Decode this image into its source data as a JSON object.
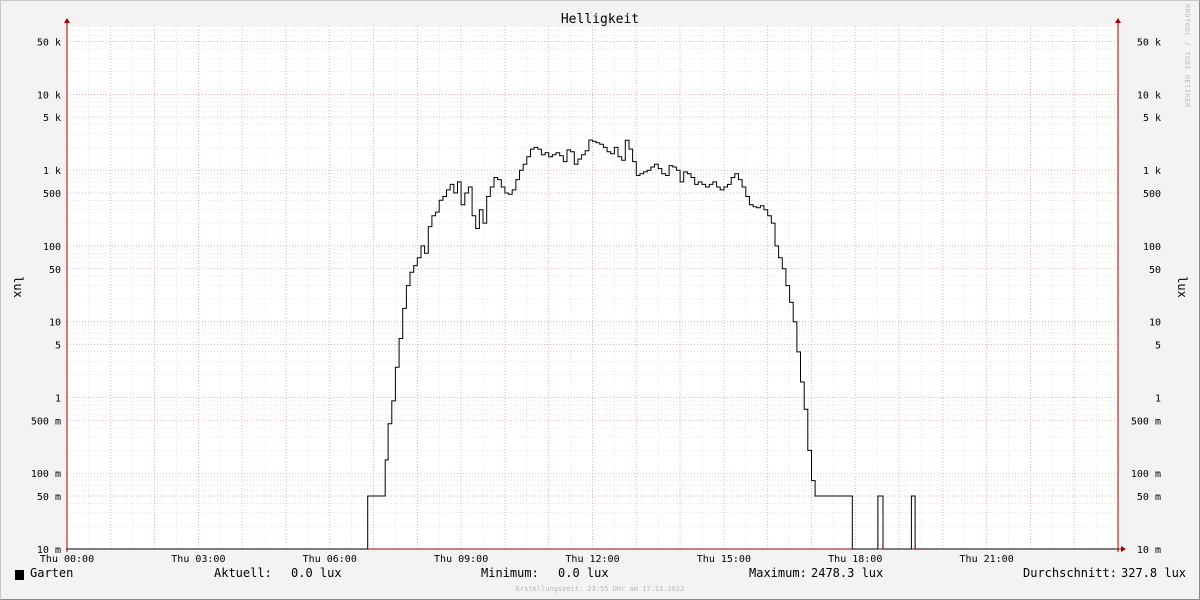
{
  "chart_data": {
    "type": "line",
    "title": "Helligkeit",
    "ylabel": "lux",
    "y_scale": "log",
    "ylim": [
      0.01,
      80000
    ],
    "xlim": [
      "00:00",
      "24:00"
    ],
    "grid": true,
    "y_ticks": [
      {
        "value": 50000,
        "label": "50 k"
      },
      {
        "value": 10000,
        "label": "10 k"
      },
      {
        "value": 5000,
        "label": "5 k"
      },
      {
        "value": 1000,
        "label": "1 k"
      },
      {
        "value": 500,
        "label": "500"
      },
      {
        "value": 100,
        "label": "100"
      },
      {
        "value": 50,
        "label": "50"
      },
      {
        "value": 10,
        "label": "10"
      },
      {
        "value": 5,
        "label": "5"
      },
      {
        "value": 1,
        "label": "1"
      },
      {
        "value": 0.5,
        "label": "500 m"
      },
      {
        "value": 0.1,
        "label": "100 m"
      },
      {
        "value": 0.05,
        "label": "50 m"
      },
      {
        "value": 0.01,
        "label": "10 m"
      }
    ],
    "x_ticks": [
      {
        "value": "00:00",
        "label": "Thu 00:00"
      },
      {
        "value": "03:00",
        "label": "Thu 03:00"
      },
      {
        "value": "06:00",
        "label": "Thu 06:00"
      },
      {
        "value": "09:00",
        "label": "Thu 09:00"
      },
      {
        "value": "12:00",
        "label": "Thu 12:00"
      },
      {
        "value": "15:00",
        "label": "Thu 15:00"
      },
      {
        "value": "18:00",
        "label": "Thu 18:00"
      },
      {
        "value": "21:00",
        "label": "Thu 21:00"
      }
    ],
    "series": [
      {
        "name": "Garten",
        "color": "#000000",
        "points": [
          [
            "00:00",
            0.01
          ],
          [
            "06:51",
            0.01
          ],
          [
            "06:52",
            0.05
          ],
          [
            "07:15",
            0.05
          ],
          [
            "07:16",
            0.15
          ],
          [
            "07:20",
            0.45
          ],
          [
            "07:25",
            0.9
          ],
          [
            "07:30",
            2.5
          ],
          [
            "07:35",
            6
          ],
          [
            "07:40",
            15
          ],
          [
            "07:45",
            30
          ],
          [
            "07:50",
            45
          ],
          [
            "07:55",
            55
          ],
          [
            "08:00",
            70
          ],
          [
            "08:05",
            100
          ],
          [
            "08:10",
            80
          ],
          [
            "08:15",
            180
          ],
          [
            "08:20",
            250
          ],
          [
            "08:25",
            280
          ],
          [
            "08:30",
            400
          ],
          [
            "08:35",
            450
          ],
          [
            "08:40",
            550
          ],
          [
            "08:45",
            650
          ],
          [
            "08:50",
            500
          ],
          [
            "08:55",
            700
          ],
          [
            "09:00",
            350
          ],
          [
            "09:05",
            500
          ],
          [
            "09:10",
            600
          ],
          [
            "09:15",
            250
          ],
          [
            "09:20",
            170
          ],
          [
            "09:25",
            300
          ],
          [
            "09:30",
            200
          ],
          [
            "09:35",
            450
          ],
          [
            "09:40",
            600
          ],
          [
            "09:45",
            800
          ],
          [
            "09:50",
            750
          ],
          [
            "09:55",
            600
          ],
          [
            "10:00",
            500
          ],
          [
            "10:05",
            480
          ],
          [
            "10:10",
            550
          ],
          [
            "10:15",
            750
          ],
          [
            "10:20",
            1000
          ],
          [
            "10:25",
            1200
          ],
          [
            "10:30",
            1500
          ],
          [
            "10:35",
            1900
          ],
          [
            "10:40",
            2000
          ],
          [
            "10:45",
            1900
          ],
          [
            "10:50",
            1600
          ],
          [
            "10:55",
            1700
          ],
          [
            "11:00",
            1500
          ],
          [
            "11:05",
            1600
          ],
          [
            "11:10",
            1700
          ],
          [
            "11:15",
            1550
          ],
          [
            "11:20",
            1300
          ],
          [
            "11:25",
            1850
          ],
          [
            "11:30",
            1750
          ],
          [
            "11:35",
            1200
          ],
          [
            "11:40",
            1400
          ],
          [
            "11:45",
            1600
          ],
          [
            "11:50",
            1800
          ],
          [
            "11:55",
            2500
          ],
          [
            "12:00",
            2400
          ],
          [
            "12:05",
            2300
          ],
          [
            "12:10",
            2200
          ],
          [
            "12:15",
            2000
          ],
          [
            "12:20",
            1750
          ],
          [
            "12:25",
            1650
          ],
          [
            "12:30",
            2000
          ],
          [
            "12:35",
            1500
          ],
          [
            "12:40",
            1350
          ],
          [
            "12:45",
            2478.3
          ],
          [
            "12:50",
            1900
          ],
          [
            "12:55",
            1300
          ],
          [
            "13:00",
            850
          ],
          [
            "13:05",
            900
          ],
          [
            "13:10",
            950
          ],
          [
            "13:15",
            1000
          ],
          [
            "13:20",
            1100
          ],
          [
            "13:25",
            1200
          ],
          [
            "13:30",
            1050
          ],
          [
            "13:35",
            900
          ],
          [
            "13:40",
            850
          ],
          [
            "13:45",
            1150
          ],
          [
            "13:50",
            1100
          ],
          [
            "13:55",
            1000
          ],
          [
            "14:00",
            700
          ],
          [
            "14:05",
            950
          ],
          [
            "14:10",
            900
          ],
          [
            "14:15",
            800
          ],
          [
            "14:20",
            650
          ],
          [
            "14:25",
            700
          ],
          [
            "14:30",
            650
          ],
          [
            "14:35",
            600
          ],
          [
            "14:40",
            650
          ],
          [
            "14:45",
            700
          ],
          [
            "14:50",
            600
          ],
          [
            "14:55",
            550
          ],
          [
            "15:00",
            600
          ],
          [
            "15:05",
            650
          ],
          [
            "15:10",
            800
          ],
          [
            "15:15",
            900
          ],
          [
            "15:20",
            750
          ],
          [
            "15:25",
            600
          ],
          [
            "15:30",
            450
          ],
          [
            "15:35",
            350
          ],
          [
            "15:40",
            330
          ],
          [
            "15:45",
            320
          ],
          [
            "15:50",
            340
          ],
          [
            "15:55",
            300
          ],
          [
            "16:00",
            250
          ],
          [
            "16:05",
            200
          ],
          [
            "16:10",
            100
          ],
          [
            "16:15",
            70
          ],
          [
            "16:20",
            50
          ],
          [
            "16:25",
            30
          ],
          [
            "16:30",
            18
          ],
          [
            "16:35",
            10
          ],
          [
            "16:40",
            4
          ],
          [
            "16:45",
            1.6
          ],
          [
            "16:50",
            0.7
          ],
          [
            "16:55",
            0.2
          ],
          [
            "17:00",
            0.08
          ],
          [
            "17:05",
            0.05
          ],
          [
            "17:55",
            0.05
          ],
          [
            "17:56",
            0.01
          ],
          [
            "18:30",
            0.01
          ],
          [
            "18:31",
            0.05
          ],
          [
            "18:37",
            0.05
          ],
          [
            "18:38",
            0.01
          ],
          [
            "19:16",
            0.01
          ],
          [
            "19:17",
            0.05
          ],
          [
            "19:21",
            0.05
          ],
          [
            "19:22",
            0.01
          ],
          [
            "24:00",
            0.01
          ]
        ]
      }
    ],
    "legend": {
      "name": "Garten",
      "current_label": "Aktuell:",
      "current_value": "0.0 lux",
      "min_label": "Minimum:",
      "min_value": "0.0 lux",
      "max_label": "Maximum:",
      "max_value": "2478.3 lux",
      "avg_label": "Durchschnitt:",
      "avg_value": "327.8 lux"
    }
  },
  "credit": "RRDTOOL / TOBI OETIKER",
  "footer": "Erstellungszeit: 23:55 Uhr am 17.11.2022",
  "colors": {
    "background": "#f3f3f3",
    "plot_background": "#ffffff",
    "major_grid": "#e6a3a8",
    "minor_grid": "#d6d6d6",
    "axis": "#a80000",
    "line": "#000000"
  }
}
